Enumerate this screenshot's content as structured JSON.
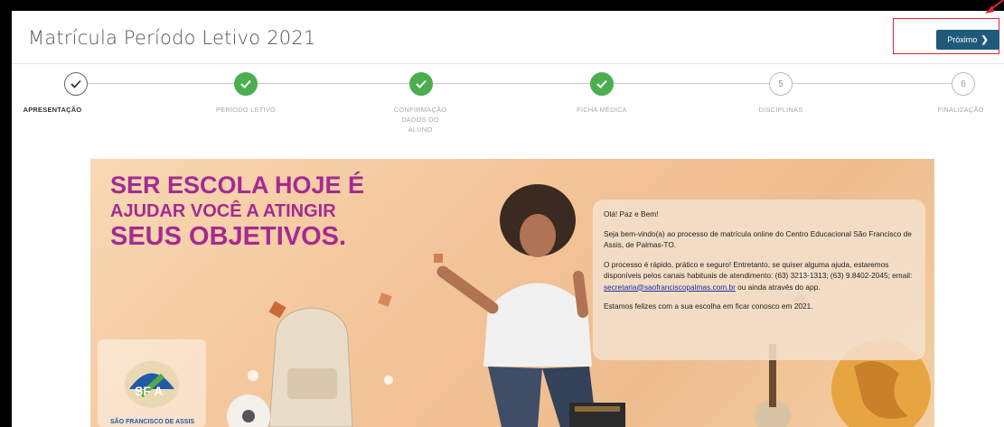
{
  "page": {
    "title": "Matrícula Período Letivo 2021"
  },
  "actions": {
    "next_label": "Próximo"
  },
  "steps": [
    {
      "label": "APRESENTAÇÃO",
      "status": "current",
      "marker": "check"
    },
    {
      "label": "PERÍODO LETIVO",
      "status": "done",
      "marker": "check"
    },
    {
      "label": "CONFIRMAÇÃO DADOS DO ALUNO",
      "status": "done",
      "marker": "check"
    },
    {
      "label": "FICHA MÉDICA",
      "status": "done",
      "marker": "check"
    },
    {
      "label": "DISCIPLINAS",
      "status": "todo",
      "marker": "5"
    },
    {
      "label": "FINALIZAÇÃO",
      "status": "todo",
      "marker": "6"
    }
  ],
  "banner": {
    "headline1": "SER ESCOLA HOJE É",
    "headline2": "AJUDAR VOCÊ A ATINGIR",
    "headline3": "SEUS OBJETIVOS.",
    "greeting": "Olá! Paz e Bem!",
    "para1": "Seja bem-vindo(a) ao processo de matrícula online do Centro Educacional São Francisco de Assis, de Palmas-TO.",
    "para2_before": "O processo é rápido, prático e seguro! Entretanto, se quiser alguma ajuda, estaremos disponíveis pelos canais habituais de atendimento: (63) 3213-1313; (63) 9.8402-2045; email: ",
    "email": "secretaria@saofranciscopalmas.com.br",
    "para2_after": " ou ainda através do app.",
    "para3": "Estamos felizes com a sua escolha em ficar conosco em 2021.",
    "logo_text": "SÃO FRANCISCO DE ASSIS"
  },
  "colors": {
    "accent": "#1f5a7a",
    "done": "#4bae4f",
    "headline": "#a52a92",
    "highlight": "#e0232e"
  }
}
